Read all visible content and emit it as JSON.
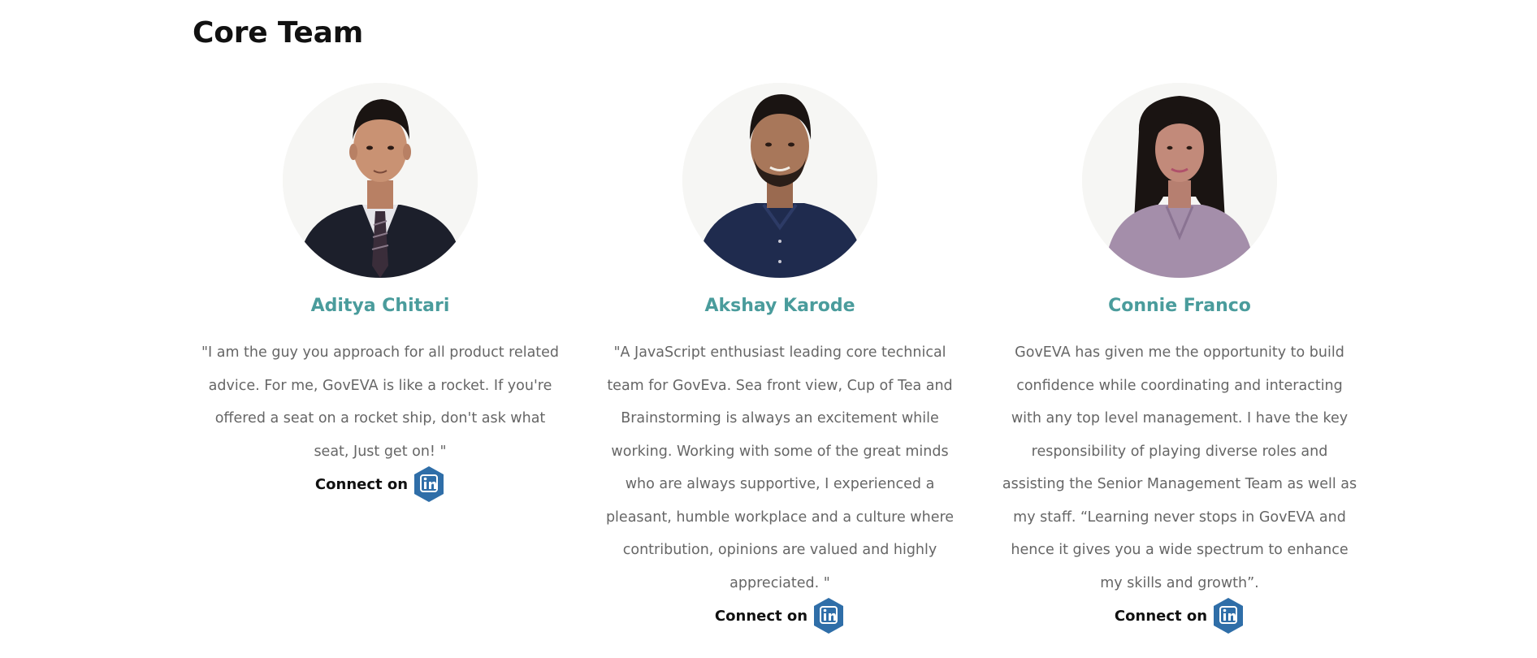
{
  "section": {
    "title": "Core Team"
  },
  "members": [
    {
      "name": "Aditya Chitari",
      "bio": "\"I am the guy you approach for all product related advice. For me, GovEVA is like a rocket. If you're offered a seat on a rocket ship, don't ask what seat, Just get on! \"",
      "connect_label": "Connect on",
      "connect_icon": "linkedin-icon",
      "photo_desc_colors": {
        "suit": "#1c1f2b",
        "shirt": "#e6e6ea",
        "skin": "#c99273",
        "hair": "#1a1412"
      }
    },
    {
      "name": "Akshay Karode",
      "bio": "\"A JavaScript enthusiast leading core technical team for GovEva.  Sea front view, Cup of Tea and Brainstorming is always an excitement while working. Working with some of the great minds who are always supportive, I experienced a pleasant, humble workplace and a culture where contribution, opinions are valued and highly appreciated. \"",
      "connect_label": "Connect on",
      "connect_icon": "linkedin-icon",
      "photo_desc_colors": {
        "shirt": "#1f2b4e",
        "skin": "#a8775a",
        "hair": "#1a1412"
      }
    },
    {
      "name": "Connie Franco",
      "bio": "GovEVA has given me the opportunity to build confidence while coordinating and interacting with any top level management. I have the key responsibility of playing diverse roles and assisting the Senior Management Team as well as my staff. “Learning never stops in GovEVA and hence it gives you a wide spectrum to enhance my skills and growth”.",
      "connect_label": "Connect on",
      "connect_icon": "linkedin-icon",
      "photo_desc_colors": {
        "blouse": "#a48eaa",
        "skin": "#c28a7a",
        "hair": "#1a1412"
      }
    }
  ],
  "colors": {
    "name_accent": "#4a9c9c",
    "body_text": "#666666",
    "heading_text": "#111111",
    "linkedin_blue": "#2f6ea8"
  }
}
